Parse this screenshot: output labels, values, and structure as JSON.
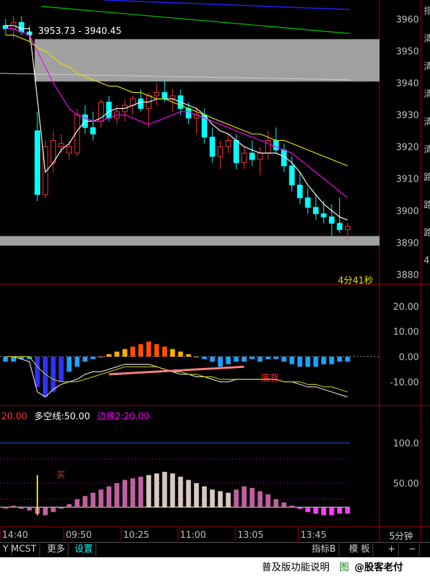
{
  "range_label": "3953.73 - 3940.45",
  "timer": "4分41秒",
  "top_axis": {
    "ticks": [
      "3960",
      "3950",
      "3940",
      "3930",
      "3920",
      "3910",
      "3900",
      "3890",
      "3880"
    ]
  },
  "right_clip": {
    "chars": [
      "指",
      "清",
      "清",
      "清",
      "清",
      "清",
      "路",
      "路",
      "路",
      "4"
    ]
  },
  "macd_axis": {
    "ticks": [
      "20.00",
      "10.00",
      "0.00",
      "-10.00"
    ]
  },
  "macd_annotation": "底背",
  "ind3_legend": {
    "left": "20.00",
    "mid_label": "多空线:",
    "mid_value": "50.00",
    "edge_label": "边缘2:",
    "edge_value": "20.00"
  },
  "ind3_axis": {
    "ticks": [
      "100.0",
      "50.00"
    ]
  },
  "buy_marker": "买",
  "time_axis": {
    "ticks": [
      "14:40",
      "09:50",
      "10:25",
      "11:00",
      "13:05",
      "13:45"
    ],
    "period": "5分钟"
  },
  "toolbar": {
    "tabs": [
      "Y",
      "MCST",
      "更多",
      "设置"
    ],
    "right": [
      "指标B",
      "模 板",
      "+",
      "−"
    ]
  },
  "status": {
    "text": "普及版功能说明",
    "chart_btn": "图",
    "watermark": "@股客老付"
  },
  "colors": {
    "up": "#ff3232",
    "down": "#00ffff",
    "bg": "#000000",
    "gray_band": "#a0a0a0",
    "ma_white": "#ffffff",
    "ma_yellow": "#e0e000",
    "ma_magenta": "#ff00ff",
    "ma_green": "#00c000",
    "ma_blue": "#2020ff"
  },
  "chart_data": [
    {
      "type": "candlestick",
      "title": "",
      "y_range": [
        3878,
        3966
      ],
      "y_ticks": [
        3960,
        3950,
        3940,
        3930,
        3920,
        3910,
        3900,
        3890,
        3880
      ],
      "x_ticks": [
        "14:40",
        "09:50",
        "10:25",
        "11:00",
        "13:05",
        "13:45"
      ],
      "range_box": [
        3953.73,
        3940.45
      ],
      "support_band": [
        3892,
        3889
      ],
      "candles": [
        [
          3958,
          3960,
          3955,
          3957
        ],
        [
          3957,
          3961,
          3954,
          3959
        ],
        [
          3959,
          3961,
          3955,
          3956
        ],
        [
          3956,
          3958,
          3953,
          3955
        ],
        [
          3925,
          3931,
          3903,
          3905
        ],
        [
          3905,
          3922,
          3904,
          3920
        ],
        [
          3915,
          3925,
          3912,
          3922
        ],
        [
          3920,
          3924,
          3918,
          3921
        ],
        [
          3918,
          3922,
          3916,
          3920
        ],
        [
          3918,
          3932,
          3917,
          3930
        ],
        [
          3930,
          3933,
          3924,
          3926
        ],
        [
          3926,
          3931,
          3922,
          3924
        ],
        [
          3928,
          3935,
          3926,
          3934
        ],
        [
          3934,
          3936,
          3928,
          3929
        ],
        [
          3929,
          3933,
          3927,
          3931
        ],
        [
          3931,
          3935,
          3928,
          3933
        ],
        [
          3933,
          3936,
          3930,
          3935
        ],
        [
          3935,
          3938,
          3931,
          3932
        ],
        [
          3932,
          3937,
          3926,
          3936
        ],
        [
          3936,
          3940,
          3933,
          3937
        ],
        [
          3937,
          3941,
          3934,
          3935
        ],
        [
          3935,
          3938,
          3931,
          3936
        ],
        [
          3936,
          3938,
          3930,
          3932
        ],
        [
          3932,
          3934,
          3927,
          3929
        ],
        [
          3929,
          3932,
          3924,
          3930
        ],
        [
          3930,
          3932,
          3921,
          3923
        ],
        [
          3923,
          3926,
          3915,
          3917
        ],
        [
          3917,
          3922,
          3913,
          3920
        ],
        [
          3920,
          3924,
          3918,
          3922
        ],
        [
          3922,
          3924,
          3913,
          3915
        ],
        [
          3915,
          3920,
          3913,
          3918
        ],
        [
          3918,
          3922,
          3914,
          3916
        ],
        [
          3916,
          3920,
          3911,
          3918
        ],
        [
          3918,
          3925,
          3916,
          3922
        ],
        [
          3922,
          3926,
          3918,
          3919
        ],
        [
          3919,
          3921,
          3912,
          3914
        ],
        [
          3914,
          3917,
          3906,
          3908
        ],
        [
          3908,
          3912,
          3902,
          3904
        ],
        [
          3904,
          3907,
          3899,
          3901
        ],
        [
          3901,
          3905,
          3897,
          3899
        ],
        [
          3899,
          3903,
          3896,
          3898
        ],
        [
          3898,
          3902,
          3892,
          3896
        ],
        [
          3896,
          3904,
          3893,
          3894
        ],
        [
          3894,
          3896,
          3891,
          3895
        ]
      ],
      "ma": [
        {
          "color": "#ffffff",
          "values": [
            3958,
            3958,
            3957,
            3957,
            3935,
            3912,
            3915,
            3919,
            3921,
            3925,
            3928,
            3928,
            3929,
            3931,
            3932,
            3932,
            3933,
            3934,
            3934,
            3935,
            3935,
            3935,
            3934,
            3933,
            3932,
            3930,
            3927,
            3925,
            3924,
            3922,
            3920,
            3919,
            3918,
            3918,
            3918,
            3917,
            3915,
            3912,
            3908,
            3905,
            3902,
            3900,
            3898,
            3897
          ]
        },
        {
          "color": "#ff00ff",
          "values": [
            3957,
            3957,
            3956,
            3955,
            3950,
            3945,
            3940,
            3936,
            3932,
            3930,
            3929,
            3928,
            3928,
            3929,
            3930,
            3930,
            3929,
            3928,
            3927,
            3928,
            3929,
            3930,
            3931,
            3931,
            3930,
            3929,
            3928,
            3927,
            3926,
            3925,
            3924,
            3923,
            3922,
            3921,
            3920,
            3919,
            3918,
            3916,
            3914,
            3912,
            3910,
            3908,
            3906,
            3904
          ]
        },
        {
          "color": "#e0e000",
          "values": [
            3955,
            3955,
            3954,
            3953,
            3951,
            3950,
            3948,
            3946,
            3945,
            3943,
            3942,
            3941,
            3940,
            3939,
            3939,
            3938,
            3937,
            3937,
            3936,
            3935,
            3935,
            3934,
            3933,
            3932,
            3931,
            3930,
            3929,
            3928,
            3927,
            3926,
            3925,
            3924,
            3924,
            3923,
            3922,
            3922,
            3921,
            3920,
            3919,
            3918,
            3917,
            3916,
            3915,
            3914
          ]
        }
      ]
    },
    {
      "type": "macd",
      "y_range": [
        -18,
        26
      ],
      "y_ticks": [
        20,
        10,
        0,
        -10
      ],
      "bars": [
        -2,
        -2,
        -1,
        -1,
        -12,
        -16,
        -14,
        -10,
        -6,
        -4,
        -2,
        -1,
        0,
        1,
        2,
        3,
        4,
        5,
        6,
        5,
        4,
        3,
        2,
        1,
        0,
        -1,
        -2,
        -4,
        -3,
        -2,
        -2,
        -1,
        -2,
        -1,
        -1,
        -2,
        -3,
        -4,
        -4,
        -4,
        -3,
        -3,
        -2,
        -2
      ],
      "dif": [
        0,
        0,
        -1,
        -2,
        -14,
        -16,
        -13,
        -11,
        -10,
        -9,
        -7,
        -6,
        -6,
        -5,
        -4,
        -3,
        -3,
        -3,
        -3,
        -4,
        -5,
        -6,
        -7,
        -7,
        -8,
        -8,
        -9,
        -10,
        -10,
        -9,
        -9,
        -9,
        -9,
        -9,
        -9,
        -10,
        -10,
        -11,
        -12,
        -12,
        -13,
        -14,
        -15,
        -16
      ],
      "dea": [
        0,
        0,
        0,
        0,
        -4,
        -7,
        -9,
        -10,
        -10,
        -10,
        -9,
        -8,
        -7,
        -6,
        -5,
        -4,
        -4,
        -4,
        -4,
        -4,
        -5,
        -6,
        -6,
        -7,
        -7,
        -8,
        -8,
        -9,
        -9,
        -9,
        -9,
        -9,
        -9,
        -9,
        -9,
        -10,
        -10,
        -10,
        -11,
        -11,
        -12,
        -12,
        -13,
        -14
      ]
    },
    {
      "type": "bar",
      "y_range": [
        0,
        125
      ],
      "y_ticks": [
        100,
        50
      ],
      "ref_line": 100,
      "bars": [
        20,
        22,
        18,
        16,
        12,
        10,
        14,
        20,
        24,
        30,
        34,
        38,
        42,
        46,
        50,
        54,
        56,
        58,
        60,
        62,
        64,
        62,
        58,
        54,
        50,
        46,
        42,
        40,
        38,
        42,
        46,
        44,
        40,
        36,
        30,
        26,
        22,
        18,
        14,
        12,
        10,
        10,
        12,
        12
      ]
    }
  ]
}
